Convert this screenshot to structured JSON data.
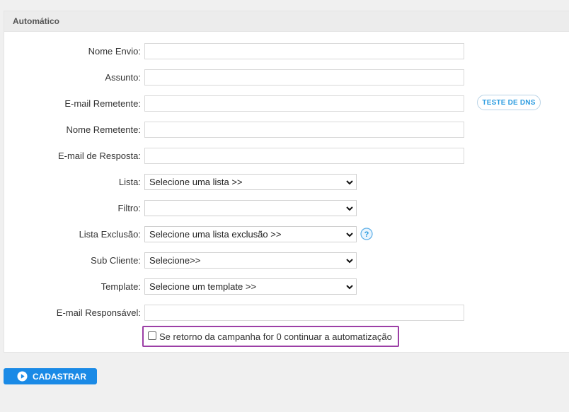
{
  "panel": {
    "title": "Automático"
  },
  "fields": {
    "nome_envio": {
      "label": "Nome Envio:",
      "value": ""
    },
    "assunto": {
      "label": "Assunto:",
      "value": ""
    },
    "email_remetente": {
      "label": "E-mail Remetente:",
      "value": ""
    },
    "nome_remetente": {
      "label": "Nome Remetente:",
      "value": ""
    },
    "email_resposta": {
      "label": "E-mail de Resposta:",
      "value": ""
    },
    "lista": {
      "label": "Lista:",
      "selected": "Selecione uma lista >>"
    },
    "filtro": {
      "label": "Filtro:",
      "selected": ""
    },
    "lista_exclusao": {
      "label": "Lista Exclusão:",
      "selected": "Selecione uma lista exclusão >>"
    },
    "sub_cliente": {
      "label": "Sub Cliente:",
      "selected": "Selecione>>"
    },
    "template": {
      "label": "Template:",
      "selected": "Selecione um template >>"
    },
    "email_responsavel": {
      "label": "E-mail Responsável:",
      "value": ""
    }
  },
  "dns_button": {
    "label": "TESTE DE DNS"
  },
  "help_icon": {
    "glyph": "?",
    "icon": "question-circle-icon"
  },
  "checkbox": {
    "label": "Se retorno da campanha for 0 continuar a automatização",
    "checked": false
  },
  "submit": {
    "label": "CADASTRAR",
    "icon": "play-circle-icon"
  },
  "colors": {
    "accent": "#1a8ae6",
    "highlight": "#9c3fa6",
    "dns_text": "#2a9be0"
  }
}
